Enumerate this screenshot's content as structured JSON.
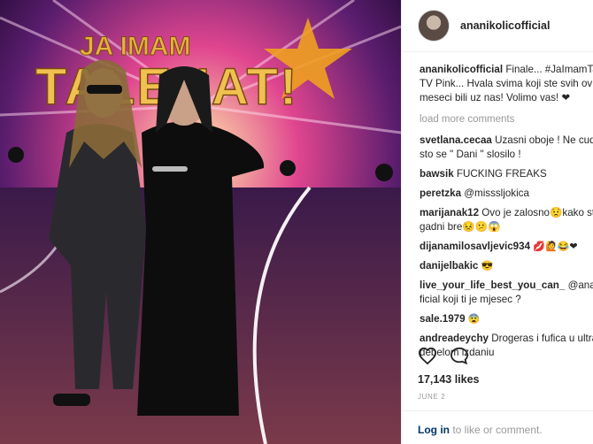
{
  "photo": {
    "sign_line1": "JA IMAM",
    "sign_line2": "TALENAT!"
  },
  "post": {
    "username": "ananikolicofficial",
    "caption_user": "ananikolicofficial",
    "caption_line1": "Finale... #JaImamTale",
    "caption_line2": "TV Pink... Hvala svima koji ste svih ovih",
    "caption_line3": "meseci bili uz nas! Volimo vas! ❤",
    "load_more": "load more comments",
    "comments": [
      {
        "user": "svetlana.cecaa",
        "line1": "Uzasni oboje ! Ne cudi",
        "line2": "sto se \" Dani \" slosilo !"
      },
      {
        "user": "bawsik",
        "line1": "FUCKING FREAKS"
      },
      {
        "user": "peretzka",
        "line1": "@misssljokica"
      },
      {
        "user": "marijanak12",
        "line1": "Ovo je zalosno😟kako st",
        "line2": "gadni bre😣😕😱"
      },
      {
        "user": "dijanamilosavljevic934",
        "line1": "💋🙋😂❤"
      },
      {
        "user": "danijelbakic",
        "line1": "😎"
      },
      {
        "user": "live_your_life_best_you_can_",
        "line1": "@ananik",
        "line2": "ficial koji ti je mjesec ?"
      },
      {
        "user": "sale.1979",
        "line1": "😨"
      },
      {
        "user": "andreadeychy",
        "line1": "Drogeras i fufica u ultra",
        "line2": "debelom izdaniu"
      }
    ],
    "likes": "17,143 likes",
    "date": "JUNE 2",
    "login_link": "Log in",
    "login_rest": " to like or comment.",
    "icons": {
      "like": "heart-icon",
      "comment": "comment-icon"
    }
  }
}
